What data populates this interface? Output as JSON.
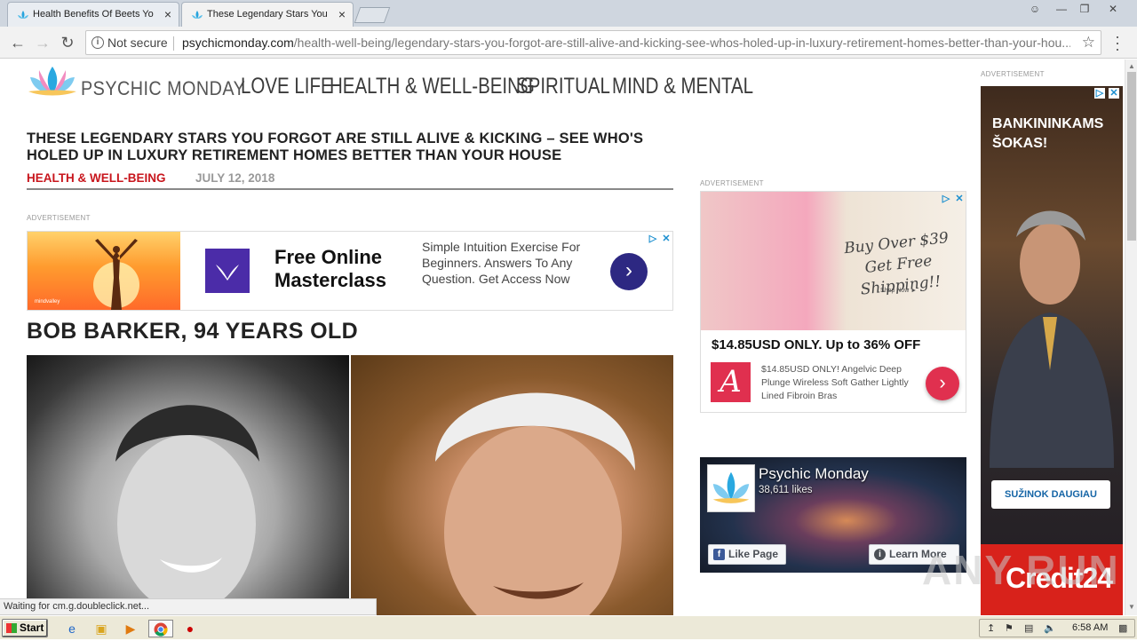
{
  "browser": {
    "tabs": [
      {
        "title": "Health Benefits Of Beets Yo",
        "active": false
      },
      {
        "title": "These Legendary Stars You",
        "active": true
      }
    ],
    "address": {
      "security_label": "Not secure",
      "domain": "psychicmonday.com",
      "path": "/health-well-being/legendary-stars-you-forgot-are-still-alive-and-kicking-see-whos-holed-up-in-luxury-retirement-homes-better-than-your-hou..."
    },
    "status_text": "Waiting for cm.g.doubleclick.net..."
  },
  "site": {
    "logo_text": "PSYCHIC MONDAY",
    "nav": [
      "LOVE LIFE",
      "HEALTH & WELL-BEING",
      "SPIRITUAL",
      "MIND & MENTAL"
    ]
  },
  "article": {
    "title": "THESE LEGENDARY STARS YOU FORGOT ARE STILL ALIVE & KICKING – SEE WHO'S HOLED UP IN LUXURY RETIREMENT HOMES BETTER THAN YOUR HOUSE",
    "category": "HEALTH & WELL-BEING",
    "date": "JULY 12, 2018",
    "section_heading": "BOB BARKER, 94 YEARS OLD"
  },
  "ads": {
    "label": "ADVERTISEMENT",
    "masterclass": {
      "brand": "mindvalley",
      "headline": "Free Online Masterclass",
      "body": "Simple Intuition Exercise For Beginners. Answers To Any Question. Get Access Now",
      "cta_icon": "chevron-right-icon"
    },
    "bra": {
      "promo": "Buy Over $39 Get Free Shipping!!",
      "shop_now": "Shop Now ►",
      "price": "$14.85USD ONLY. Up to 36% OFF",
      "description": "$14.85USD ONLY! Angelvic Deep Plunge Wireless Soft Gather Lightly Lined Fibroin Bras",
      "brand_letter": "A"
    },
    "credit24": {
      "headline": "BANKININKAMS ŠOKAS!",
      "button": "SUŽINOK DAUGIAU",
      "brand": "Credit24"
    }
  },
  "facebook": {
    "page_name": "Psychic Monday",
    "likes": "38,611 likes",
    "like_button": "Like Page",
    "learn_button": "Learn More"
  },
  "watermark": "ANY RUN",
  "taskbar": {
    "start_label": "Start",
    "clock": "6:58 AM"
  },
  "colors": {
    "accent_red": "#c8161d",
    "ad_purple": "#2d2882",
    "ad_pink": "#e0304f",
    "facebook_blue": "#3b5998"
  }
}
